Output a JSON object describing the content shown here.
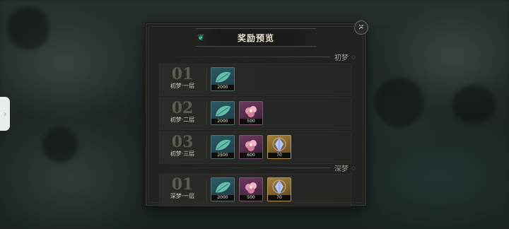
{
  "modal": {
    "title": "奖励预览",
    "close_icon": "close-icon"
  },
  "sections": [
    {
      "label": "初梦",
      "rows": [
        {
          "num": "01",
          "label": "初梦·一层",
          "items": [
            {
              "icon": "green-leaf-icon",
              "kind": "leaf",
              "qty": "2000"
            }
          ]
        },
        {
          "num": "02",
          "label": "初梦·二层",
          "items": [
            {
              "icon": "green-leaf-icon",
              "kind": "leaf",
              "qty": "2000"
            },
            {
              "icon": "pink-flower-icon",
              "kind": "flower",
              "qty": "500"
            }
          ]
        },
        {
          "num": "03",
          "label": "初梦·三层",
          "items": [
            {
              "icon": "green-leaf-icon",
              "kind": "leaf",
              "qty": "2500"
            },
            {
              "icon": "pink-flower-icon",
              "kind": "flower",
              "qty": "600"
            },
            {
              "icon": "blue-crystal-icon",
              "kind": "crystal",
              "qty": "70"
            }
          ]
        }
      ]
    },
    {
      "label": "深梦",
      "rows": [
        {
          "num": "01",
          "label": "深梦·一层",
          "items": [
            {
              "icon": "green-leaf-icon",
              "kind": "leaf",
              "qty": "2000"
            },
            {
              "icon": "pink-flower-icon",
              "kind": "flower",
              "qty": "500"
            },
            {
              "icon": "blue-crystal-icon",
              "kind": "crystal",
              "qty": "70"
            }
          ]
        }
      ]
    }
  ],
  "colors": {
    "accent": "#3fb79f",
    "panel": "#222220",
    "text": "#e9e2cf"
  }
}
